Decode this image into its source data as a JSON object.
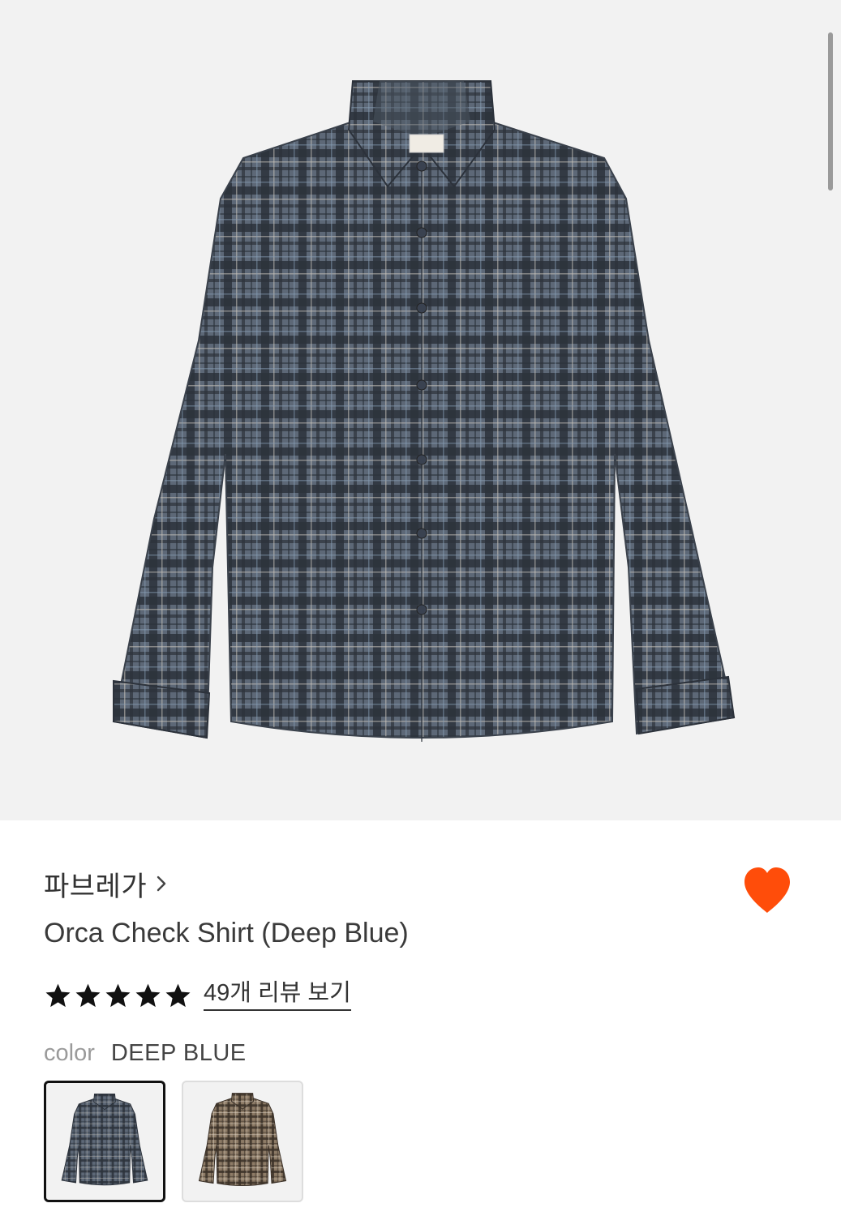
{
  "product": {
    "brand": "파브레가",
    "title": "Orca Check Shirt (Deep Blue)",
    "rating_stars": 5,
    "review_link": "49개 리뷰 보기",
    "color_label": "color",
    "color_value": "DEEP BLUE",
    "favorited": true
  },
  "colors": {
    "heart": "#ff4d0a",
    "deep_blue_base": "#5a6675",
    "brown_base": "#8b7a66"
  },
  "swatches": [
    {
      "name": "deep-blue",
      "selected": true
    },
    {
      "name": "brown",
      "selected": false
    }
  ]
}
